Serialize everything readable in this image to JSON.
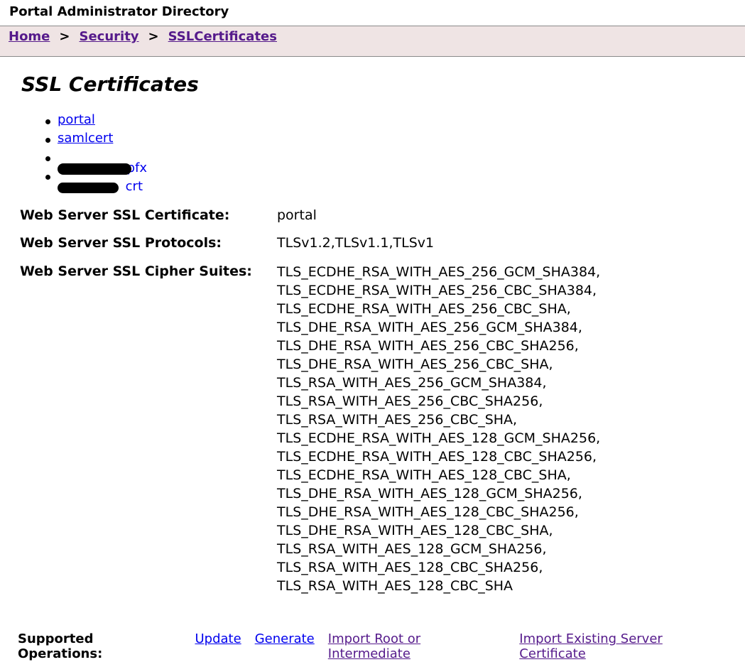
{
  "header": {
    "title": "Portal Administrator Directory"
  },
  "breadcrumb": {
    "items": [
      {
        "label": "Home"
      },
      {
        "label": "Security"
      },
      {
        "label": "SSLCertificates"
      }
    ],
    "separator": ">"
  },
  "page_title": "SSL Certificates",
  "certificates": [
    {
      "label": "portal",
      "redacted": false
    },
    {
      "label": "samlcert",
      "redacted": false
    },
    {
      "label": "pfx",
      "redacted": true
    },
    {
      "label": "crt",
      "redacted": true
    }
  ],
  "details": {
    "certificate": {
      "label": "Web Server SSL Certificate:",
      "value": "portal"
    },
    "protocols": {
      "label": "Web Server SSL Protocols:",
      "value": "TLSv1.2,TLSv1.1,TLSv1"
    },
    "cipher_suites": {
      "label": "Web Server SSL Cipher Suites:",
      "values": [
        "TLS_ECDHE_RSA_WITH_AES_256_GCM_SHA384,",
        "TLS_ECDHE_RSA_WITH_AES_256_CBC_SHA384,",
        "TLS_ECDHE_RSA_WITH_AES_256_CBC_SHA,",
        "TLS_DHE_RSA_WITH_AES_256_GCM_SHA384,",
        "TLS_DHE_RSA_WITH_AES_256_CBC_SHA256,",
        "TLS_DHE_RSA_WITH_AES_256_CBC_SHA,",
        "TLS_RSA_WITH_AES_256_GCM_SHA384,",
        "TLS_RSA_WITH_AES_256_CBC_SHA256,",
        "TLS_RSA_WITH_AES_256_CBC_SHA,",
        "TLS_ECDHE_RSA_WITH_AES_128_GCM_SHA256,",
        "TLS_ECDHE_RSA_WITH_AES_128_CBC_SHA256,",
        "TLS_ECDHE_RSA_WITH_AES_128_CBC_SHA,",
        "TLS_DHE_RSA_WITH_AES_128_GCM_SHA256,",
        "TLS_DHE_RSA_WITH_AES_128_CBC_SHA256,",
        "TLS_DHE_RSA_WITH_AES_128_CBC_SHA,",
        "TLS_RSA_WITH_AES_128_GCM_SHA256,",
        "TLS_RSA_WITH_AES_128_CBC_SHA256,",
        "TLS_RSA_WITH_AES_128_CBC_SHA"
      ]
    }
  },
  "operations": {
    "label": "Supported Operations:",
    "links": [
      {
        "label": "Update",
        "visited": false
      },
      {
        "label": "Generate",
        "visited": false
      },
      {
        "label": "Import Root or Intermediate",
        "visited": true
      },
      {
        "label": "Import Existing Server Certificate",
        "visited": true
      }
    ]
  },
  "colors": {
    "link": "#0000ee",
    "visited_link": "#551a8b",
    "breadcrumb_bg": "#efe4e4"
  }
}
